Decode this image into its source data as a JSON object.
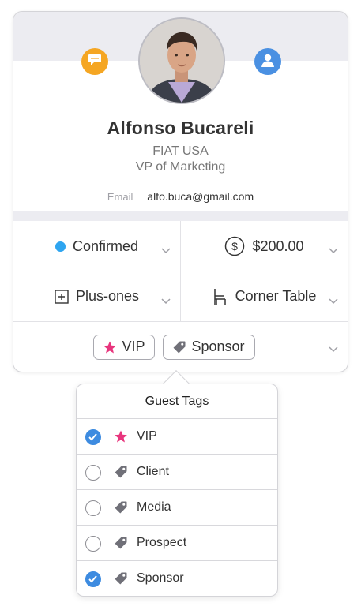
{
  "profile": {
    "name": "Alfonso Bucareli",
    "company": "FIAT USA",
    "title": "VP of Marketing",
    "email_label": "Email",
    "email": "alfo.buca@gmail.com"
  },
  "fields": {
    "status": {
      "label": "Confirmed",
      "color": "#2ea5f0"
    },
    "amount": {
      "label": "$200.00"
    },
    "plus_ones": {
      "label": "Plus-ones"
    },
    "table": {
      "label": "Corner Table"
    }
  },
  "tags": [
    {
      "label": "VIP",
      "icon": "star-icon"
    },
    {
      "label": "Sponsor",
      "icon": "tag-icon"
    }
  ],
  "popover": {
    "title": "Guest Tags",
    "items": [
      {
        "label": "VIP",
        "icon": "star-icon",
        "checked": true
      },
      {
        "label": "Client",
        "icon": "tag-icon",
        "checked": false
      },
      {
        "label": "Media",
        "icon": "tag-icon",
        "checked": false
      },
      {
        "label": "Prospect",
        "icon": "tag-icon",
        "checked": false
      },
      {
        "label": "Sponsor",
        "icon": "tag-icon",
        "checked": true
      }
    ]
  },
  "colors": {
    "accent_blue": "#3d8be0",
    "chat_orange": "#f5a623",
    "profile_blue": "#4a90e2",
    "vip_pink": "#e8357d",
    "tag_gray": "#707078"
  }
}
